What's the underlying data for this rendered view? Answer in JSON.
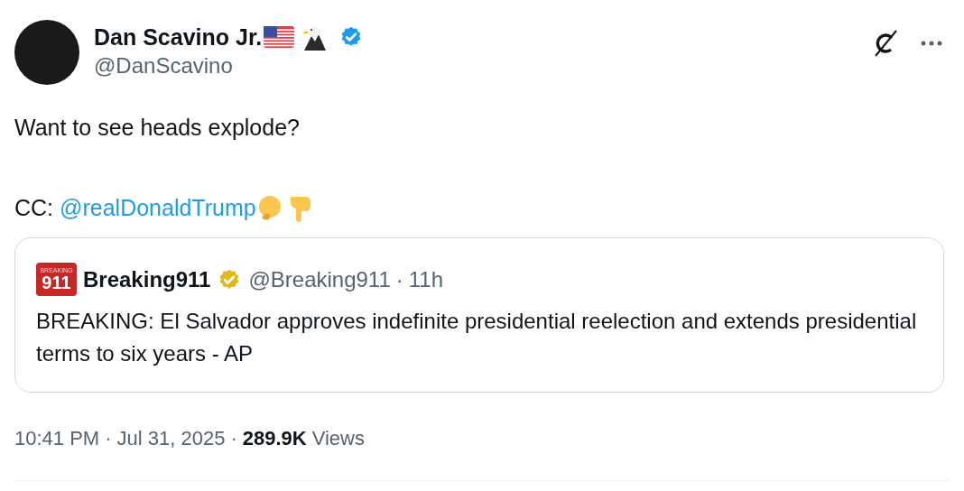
{
  "author": {
    "name": "Dan Scavino Jr.",
    "handle": "@DanScavino",
    "verified": true
  },
  "body": {
    "line_1": "Want to see heads explode?",
    "cc_label": "CC:",
    "mention": "@realDonaldTrump"
  },
  "quote": {
    "logo_top": "BREAKING",
    "logo_number": "911",
    "name": "Breaking911",
    "verified": true,
    "handle": "@Breaking911",
    "separator": "·",
    "time": "11h",
    "text": "BREAKING: El Salvador approves indefinite presidential reelection and extends presidential terms to six years - AP"
  },
  "meta": {
    "time": "10:41 PM",
    "separator_1": "·",
    "date": "Jul 31, 2025",
    "separator_2": "·",
    "views_count": "289.9K",
    "views_label": "Views"
  }
}
